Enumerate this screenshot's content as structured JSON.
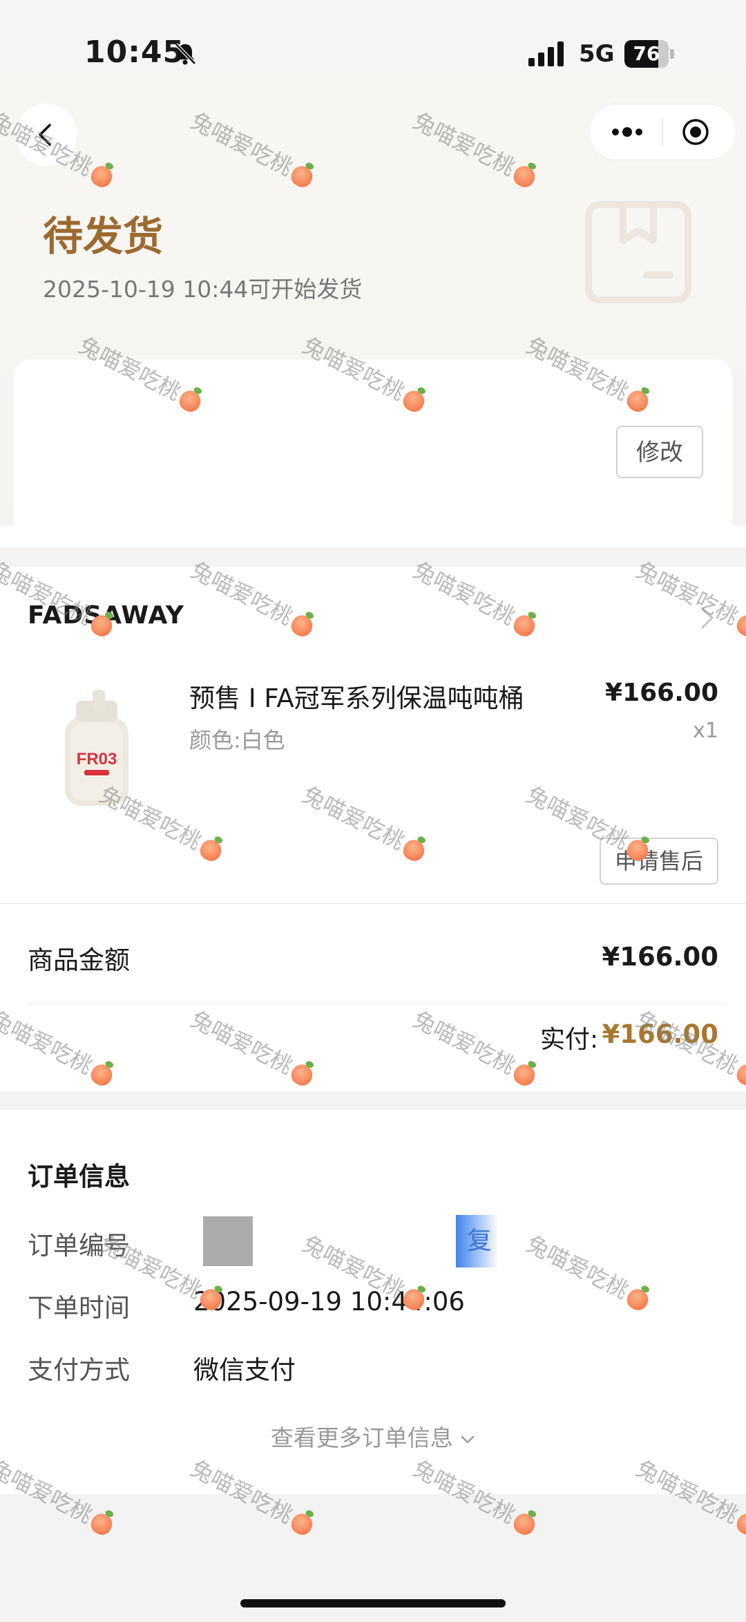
{
  "status_bar": {
    "time": "10:45",
    "network": "5G",
    "battery": "76",
    "battery_level": 0.76
  },
  "header": {
    "status_title": "待发货",
    "status_subtitle": "2025-10-19 10:44可开始发货"
  },
  "address": {
    "edit_label": "修改"
  },
  "shop": {
    "name": "FADSAWAY",
    "product": {
      "title": "预售 I FA冠军系列保温吨吨桶",
      "spec": "颜色:白色",
      "price": "¥166.00",
      "quantity": "x1",
      "aftersale_label": "申请售后"
    }
  },
  "amounts": {
    "goods_label": "商品金额",
    "goods_value": "¥166.00",
    "paid_label": "实付:",
    "paid_value": "¥166.00"
  },
  "order_info": {
    "title": "订单信息",
    "rows": [
      {
        "label": "订单编号",
        "value": ""
      },
      {
        "label": "下单时间",
        "value": "2025-09-19 10:44:06"
      },
      {
        "label": "支付方式",
        "value": "微信支付"
      }
    ],
    "copy_label": "复制",
    "more_label": "查看更多订单信息"
  },
  "watermark_text": "兔喵爱吃桃",
  "colors": {
    "status_brown": "#9b6a2f",
    "paid_brown": "#a8772f",
    "link_blue": "#3a78e0"
  },
  "icons": [
    "bell-slash-icon",
    "signal-icon",
    "back-icon",
    "more-icon",
    "target-icon",
    "box-icon",
    "chevron-right-icon",
    "chevron-down-icon",
    "peach-icon"
  ]
}
